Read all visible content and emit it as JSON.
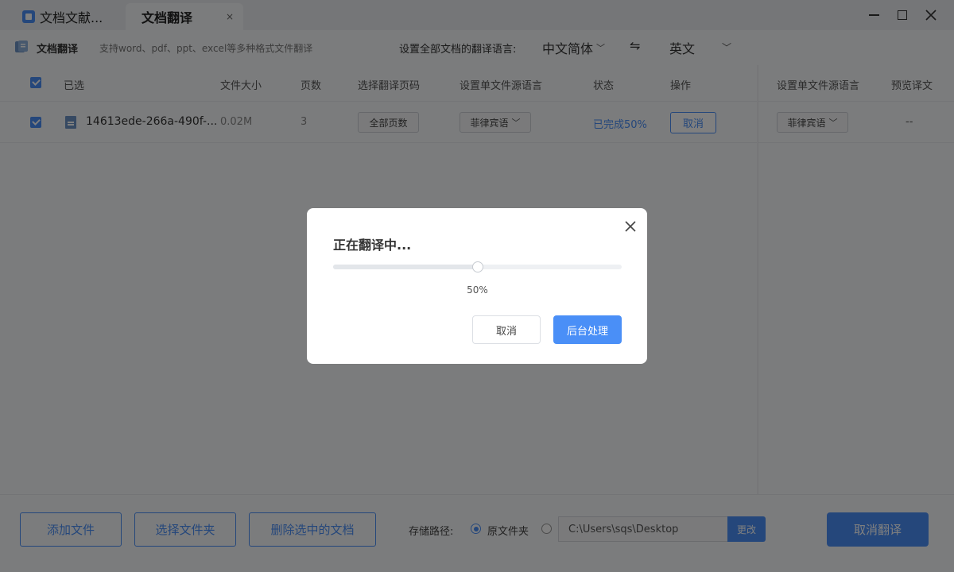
{
  "titlebar": {
    "tabs": [
      {
        "label": "文档文献..."
      },
      {
        "label": "文档翻译",
        "close": "×"
      }
    ]
  },
  "toolbar": {
    "title": "文档翻译",
    "subtitle": "支持word、pdf、ppt、excel等多种格式文件翻译",
    "lang_label": "设置全部文档的翻译语言:",
    "source_lang": "中文简体",
    "swap": "⇋",
    "target_lang": "英文"
  },
  "table": {
    "headers": [
      "已选",
      "文件大小",
      "页数",
      "选择翻译页码",
      "设置单文件源语言",
      "状态",
      "操作"
    ],
    "side_headers": [
      "设置单文件源语言",
      "预览译文"
    ],
    "rows": [
      {
        "filename": "14613ede-266a-490f-...",
        "size": "0.02M",
        "pages": "3",
        "page_range": "全部页数",
        "source_lang": "菲律宾语",
        "status": "已完成50%",
        "action": "取消",
        "side_source_lang": "菲律宾语",
        "preview": "--"
      }
    ]
  },
  "bottom": {
    "add_file": "添加文件",
    "choose_folder": "选择文件夹",
    "delete_selected": "删除选中的文档",
    "path_label": "存储路径:",
    "radio_original": "原文件夹",
    "path_value": "C:\\Users\\sqs\\Desktop",
    "change": "更改",
    "cancel_translate": "取消翻译"
  },
  "dialog": {
    "title": "正在翻译中...",
    "progress": 0.5,
    "percent_label": "50%",
    "cancel": "取消",
    "background": "后台处理"
  },
  "colors": {
    "accent": "#4a8ff7"
  }
}
